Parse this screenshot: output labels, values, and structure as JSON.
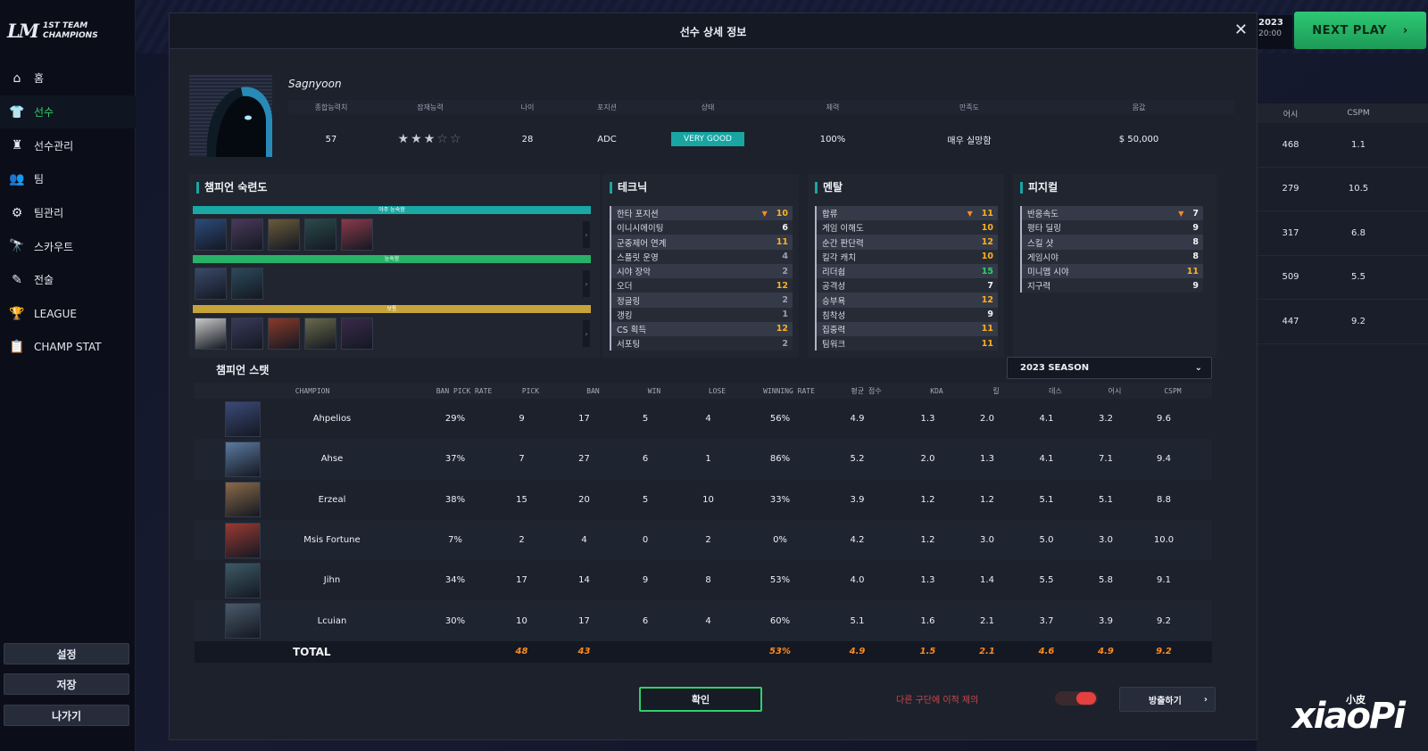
{
  "sidebar": {
    "logo": {
      "mark": "LM",
      "line1": "1ST TEAM",
      "line2": "CHAMPIONS"
    },
    "items": [
      {
        "label": "홈",
        "icon": "home-icon",
        "glyph": "⌂"
      },
      {
        "label": "선수",
        "icon": "shirt-icon",
        "glyph": "👕"
      },
      {
        "label": "선수관리",
        "icon": "trophy-cup-icon",
        "glyph": "♜"
      },
      {
        "label": "팀",
        "icon": "team-icon",
        "glyph": "👥"
      },
      {
        "label": "팀관리",
        "icon": "team-gear-icon",
        "glyph": "⚙"
      },
      {
        "label": "스카우트",
        "icon": "binoculars-icon",
        "glyph": "🔭"
      },
      {
        "label": "전술",
        "icon": "tactics-icon",
        "glyph": "✎"
      },
      {
        "label": "LEAGUE",
        "icon": "trophy-icon",
        "glyph": "🏆"
      },
      {
        "label": "CHAMP STAT",
        "icon": "clipboard-icon",
        "glyph": "📋"
      }
    ],
    "buttons": {
      "settings": "설정",
      "save": "저장",
      "exit": "나가기"
    }
  },
  "background": {
    "date": "2023",
    "time": "20:00",
    "next_play": "NEXT PLAY",
    "table_headers": [
      "어시",
      "CSPM"
    ],
    "rows": [
      [
        "468",
        "1.1"
      ],
      [
        "279",
        "10.5"
      ],
      [
        "317",
        "6.8"
      ],
      [
        "509",
        "5.5"
      ],
      [
        "447",
        "9.2"
      ]
    ]
  },
  "modal": {
    "title": "선수 상세 정보",
    "player": {
      "name": "Sagnyoon",
      "headers": [
        "종합능력치",
        "잠재능력",
        "나이",
        "포지션",
        "상태",
        "체력",
        "만족도",
        "몸값"
      ],
      "overall": "57",
      "potential_stars": 3,
      "potential_max": 5,
      "age": "28",
      "position": "ADC",
      "status": "VERY GOOD",
      "stamina": "100%",
      "satisfaction": "매우 실망함",
      "salary": "$ 50,000"
    },
    "mastery": {
      "title": "챔피언 숙련도",
      "tiers": [
        {
          "label": "아주 능숙함",
          "color": "#1aa8a5",
          "count": 5
        },
        {
          "label": "능숙함",
          "color": "#27b268",
          "count": 2
        },
        {
          "label": "보통",
          "color": "#c6a43a",
          "count": 5
        }
      ]
    },
    "technique": {
      "title": "테크닉",
      "stats": [
        {
          "name": "한타 포지션",
          "value": "10",
          "color": "#ffb020",
          "down": true
        },
        {
          "name": "이니시에이팅",
          "value": "6",
          "color": "#f1f3f7"
        },
        {
          "name": "군중제어 연계",
          "value": "11",
          "color": "#ffb020"
        },
        {
          "name": "스플릿 운영",
          "value": "4",
          "color": "#9aa0b0"
        },
        {
          "name": "시야 장악",
          "value": "2",
          "color": "#9aa0b0"
        },
        {
          "name": "오더",
          "value": "12",
          "color": "#ffb020"
        },
        {
          "name": "정글링",
          "value": "2",
          "color": "#9aa0b0"
        },
        {
          "name": "갱킹",
          "value": "1",
          "color": "#9aa0b0"
        },
        {
          "name": "CS 획득",
          "value": "12",
          "color": "#ffb020"
        },
        {
          "name": "서포팅",
          "value": "2",
          "color": "#9aa0b0"
        }
      ]
    },
    "mental": {
      "title": "멘탈",
      "stats": [
        {
          "name": "합류",
          "value": "11",
          "color": "#ffb020",
          "down": true
        },
        {
          "name": "게임 이해도",
          "value": "10",
          "color": "#ffb020"
        },
        {
          "name": "순간 판단력",
          "value": "12",
          "color": "#ffb020"
        },
        {
          "name": "킬각 캐치",
          "value": "10",
          "color": "#ffb020"
        },
        {
          "name": "리더쉽",
          "value": "15",
          "color": "#2fd06b"
        },
        {
          "name": "공격성",
          "value": "7",
          "color": "#f1f3f7"
        },
        {
          "name": "승부욕",
          "value": "12",
          "color": "#ffb020"
        },
        {
          "name": "침착성",
          "value": "9",
          "color": "#f1f3f7"
        },
        {
          "name": "집중력",
          "value": "11",
          "color": "#ffb020"
        },
        {
          "name": "팀워크",
          "value": "11",
          "color": "#ffb020"
        }
      ]
    },
    "physical": {
      "title": "피지컬",
      "stats": [
        {
          "name": "반응속도",
          "value": "7",
          "color": "#f1f3f7",
          "down": true
        },
        {
          "name": "평타 딜링",
          "value": "9",
          "color": "#f1f3f7"
        },
        {
          "name": "스킬 샷",
          "value": "8",
          "color": "#f1f3f7"
        },
        {
          "name": "게임시야",
          "value": "8",
          "color": "#f1f3f7"
        },
        {
          "name": "미니맵 시야",
          "value": "11",
          "color": "#ffb020"
        },
        {
          "name": "지구력",
          "value": "9",
          "color": "#f1f3f7"
        }
      ]
    },
    "champion_stats": {
      "title": "챔피언 스탯",
      "season": "2023 SEASON",
      "headers": [
        "CHAMPION",
        "BAN PICK RATE",
        "PICK",
        "BAN",
        "WIN",
        "LOSE",
        "WINNING RATE",
        "평균 점수",
        "KDA",
        "킬",
        "데스",
        "어시",
        "CSPM"
      ],
      "rows": [
        {
          "name": "Ahpelios",
          "ban_pick_rate": "29%",
          "pick": "9",
          "ban": "17",
          "win": "5",
          "lose": "4",
          "winning_rate": "56%",
          "avg_score": "4.9",
          "kda": "1.3",
          "kill": "2.0",
          "death": "4.1",
          "assist": "3.2",
          "cspm": "9.6",
          "color": "#3b4a78"
        },
        {
          "name": "Ahse",
          "ban_pick_rate": "37%",
          "pick": "7",
          "ban": "27",
          "win": "6",
          "lose": "1",
          "winning_rate": "86%",
          "avg_score": "5.2",
          "kda": "2.0",
          "kill": "1.3",
          "death": "4.1",
          "assist": "7.1",
          "cspm": "9.4",
          "color": "#5c7aa0"
        },
        {
          "name": "Erzeal",
          "ban_pick_rate": "38%",
          "pick": "15",
          "ban": "20",
          "win": "5",
          "lose": "10",
          "winning_rate": "33%",
          "avg_score": "3.9",
          "kda": "1.2",
          "kill": "1.2",
          "death": "5.1",
          "assist": "5.1",
          "cspm": "8.8",
          "color": "#8a6a48"
        },
        {
          "name": "Msis Fortune",
          "ban_pick_rate": "7%",
          "pick": "2",
          "ban": "4",
          "win": "0",
          "lose": "2",
          "winning_rate": "0%",
          "avg_score": "4.2",
          "kda": "1.2",
          "kill": "3.0",
          "death": "5.0",
          "assist": "3.0",
          "cspm": "10.0",
          "color": "#9a3a32"
        },
        {
          "name": "Jihn",
          "ban_pick_rate": "34%",
          "pick": "17",
          "ban": "14",
          "win": "9",
          "lose": "8",
          "winning_rate": "53%",
          "avg_score": "4.0",
          "kda": "1.3",
          "kill": "1.4",
          "death": "5.5",
          "assist": "5.8",
          "cspm": "9.1",
          "color": "#3c5a66"
        },
        {
          "name": "Lcuian",
          "ban_pick_rate": "30%",
          "pick": "10",
          "ban": "17",
          "win": "6",
          "lose": "4",
          "winning_rate": "60%",
          "avg_score": "5.1",
          "kda": "1.6",
          "kill": "2.1",
          "death": "3.7",
          "assist": "3.9",
          "cspm": "9.2",
          "color": "#4a5a6a"
        }
      ],
      "total": {
        "label": "TOTAL",
        "pick": "48",
        "ban": "43",
        "winning_rate": "53%",
        "avg_score": "4.9",
        "kda": "1.5",
        "kill": "2.1",
        "death": "4.6",
        "assist": "4.9",
        "cspm": "9.2"
      }
    },
    "footer": {
      "confirm": "확인",
      "exclude_text": "다른 구단에 이적 제의",
      "toggle_on": true,
      "release": "방출하기"
    }
  },
  "watermark": {
    "text": "xiaoPi",
    "small": "小皮"
  }
}
